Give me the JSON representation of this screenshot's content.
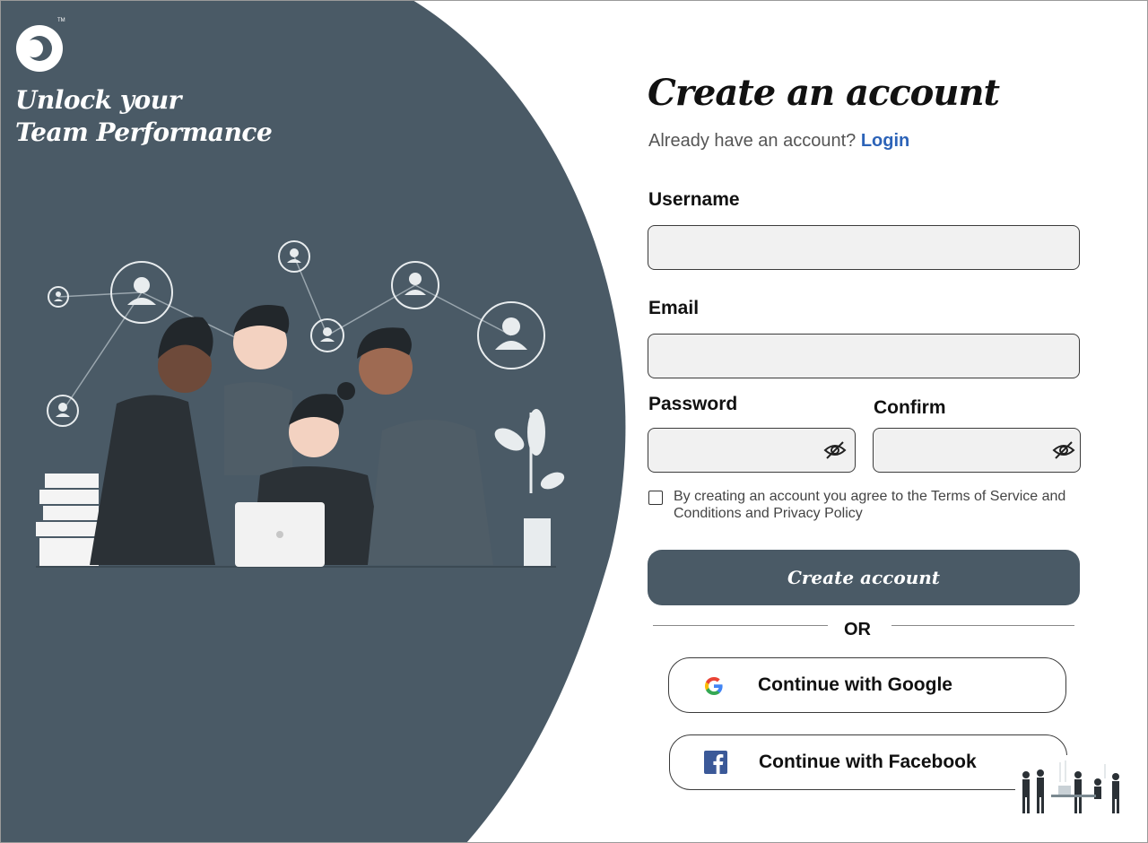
{
  "hero": {
    "tagline_line1": "Unlock your",
    "tagline_line2": "Team Performance"
  },
  "form": {
    "title": "Create an account",
    "already_text": "Already have an account?",
    "login_link": "Login",
    "username_label": "Username",
    "email_label": "Email",
    "password_label": "Password",
    "confirm_label": "Confirm",
    "username_value": "",
    "email_value": "",
    "password_value": "",
    "confirm_value": "",
    "terms_text": "By creating an account you agree to the Terms of Service and Conditions and Privacy Policy",
    "create_button": "Create account",
    "or_text": "OR",
    "google_button": "Continue with Google",
    "facebook_button": "Continue with Facebook"
  },
  "colors": {
    "panel": "#4a5a66",
    "link": "#2c63b8"
  },
  "icons": {
    "logo": "brand-logo-icon",
    "eye": "eye-off-icon",
    "google": "google-icon",
    "facebook": "facebook-icon"
  }
}
